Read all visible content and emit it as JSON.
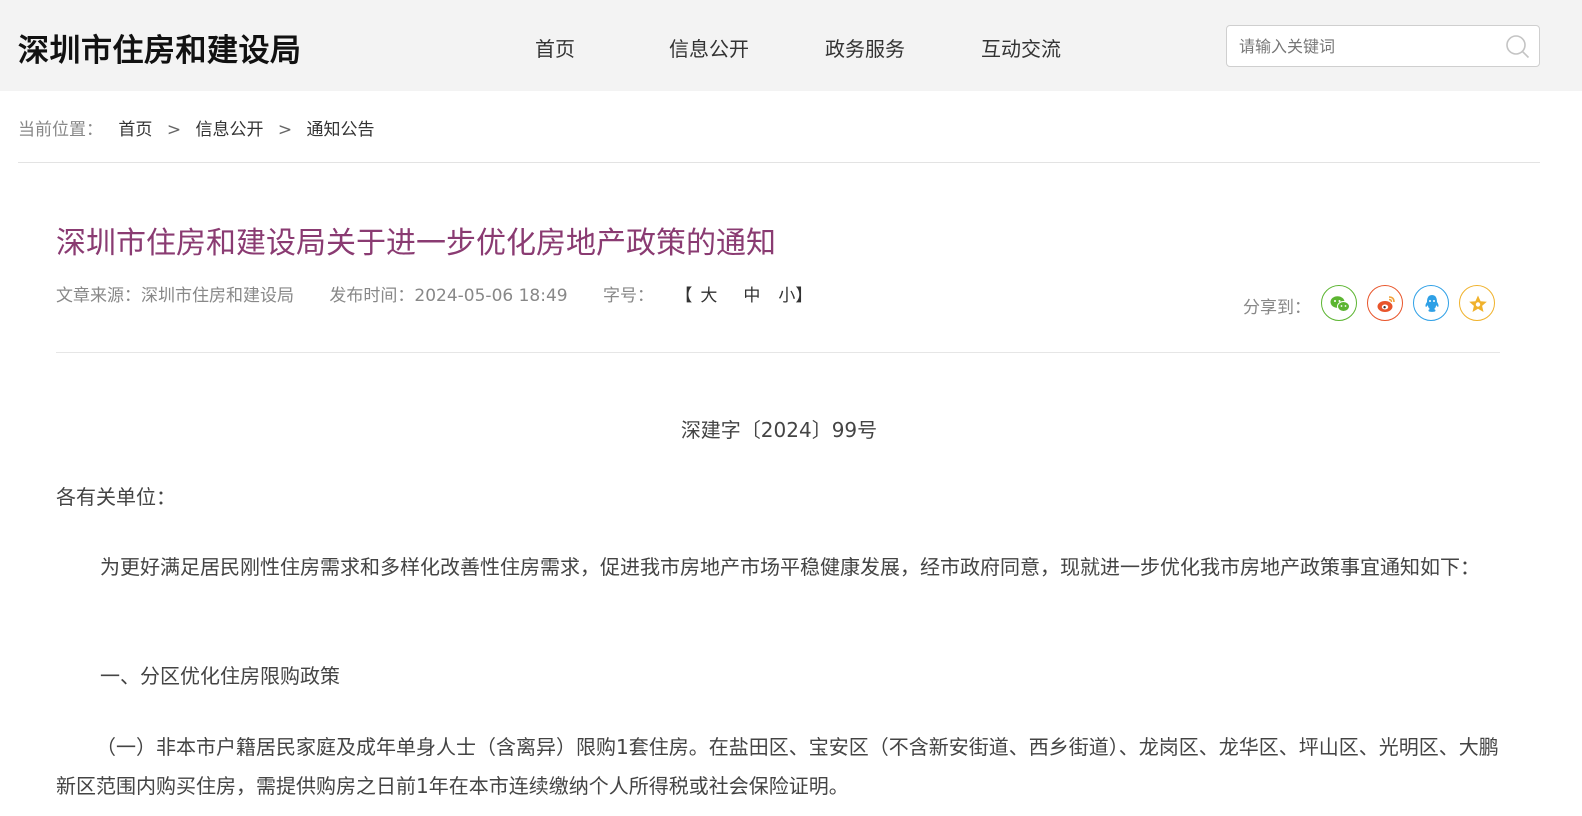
{
  "site": {
    "logo": "深圳市住房和建设局"
  },
  "nav": {
    "items": [
      "首页",
      "信息公开",
      "政务服务",
      "互动交流"
    ]
  },
  "search": {
    "placeholder": "请输入关键词",
    "value": "",
    "icon": "search-icon"
  },
  "breadcrumb": {
    "label": "当前位置：",
    "items": [
      "首页",
      "信息公开",
      "通知公告"
    ],
    "separator": ">"
  },
  "article": {
    "title": "深圳市住房和建设局关于进一步优化房地产政策的通知",
    "source_label": "文章来源：",
    "source": "深圳市住房和建设局",
    "time_label": "发布时间：",
    "time": "2024-05-06 18:49",
    "fontsize_label": "字号：",
    "bracket_open": "【",
    "bracket_close": "】",
    "fontsizes": [
      "大",
      "中",
      "小"
    ],
    "doc_number": "深建字〔2024〕99号",
    "greeting": "各有关单位：",
    "paragraphs": [
      "为更好满足居民刚性住房需求和多样化改善性住房需求，促进我市房地产市场平稳健康发展，经市政府同意，现就进一步优化我市房地产政策事宜通知如下：",
      "一、分区优化住房限购政策",
      "（一）非本市户籍居民家庭及成年单身人士（含离异）限购1套住房。在盐田区、宝安区（不含新安街道、西乡街道）、龙岗区、龙华区、坪山区、光明区、大鹏新区范围内购买住房，需提供购房之日前1年在本市连续缴纳个人所得税或社会保险证明。"
    ]
  },
  "share": {
    "label": "分享到：",
    "buttons": [
      {
        "name": "wechat",
        "icon": "wechat-icon",
        "color": "#5cb531"
      },
      {
        "name": "weibo",
        "icon": "weibo-icon",
        "color": "#e8552b"
      },
      {
        "name": "qq",
        "icon": "qq-icon",
        "color": "#2fa0e6"
      },
      {
        "name": "favorite",
        "icon": "star-icon",
        "color": "#f0b22c"
      }
    ]
  },
  "colors": {
    "title": "#8a3b72",
    "topbar_bg": "#f3f3f3"
  }
}
